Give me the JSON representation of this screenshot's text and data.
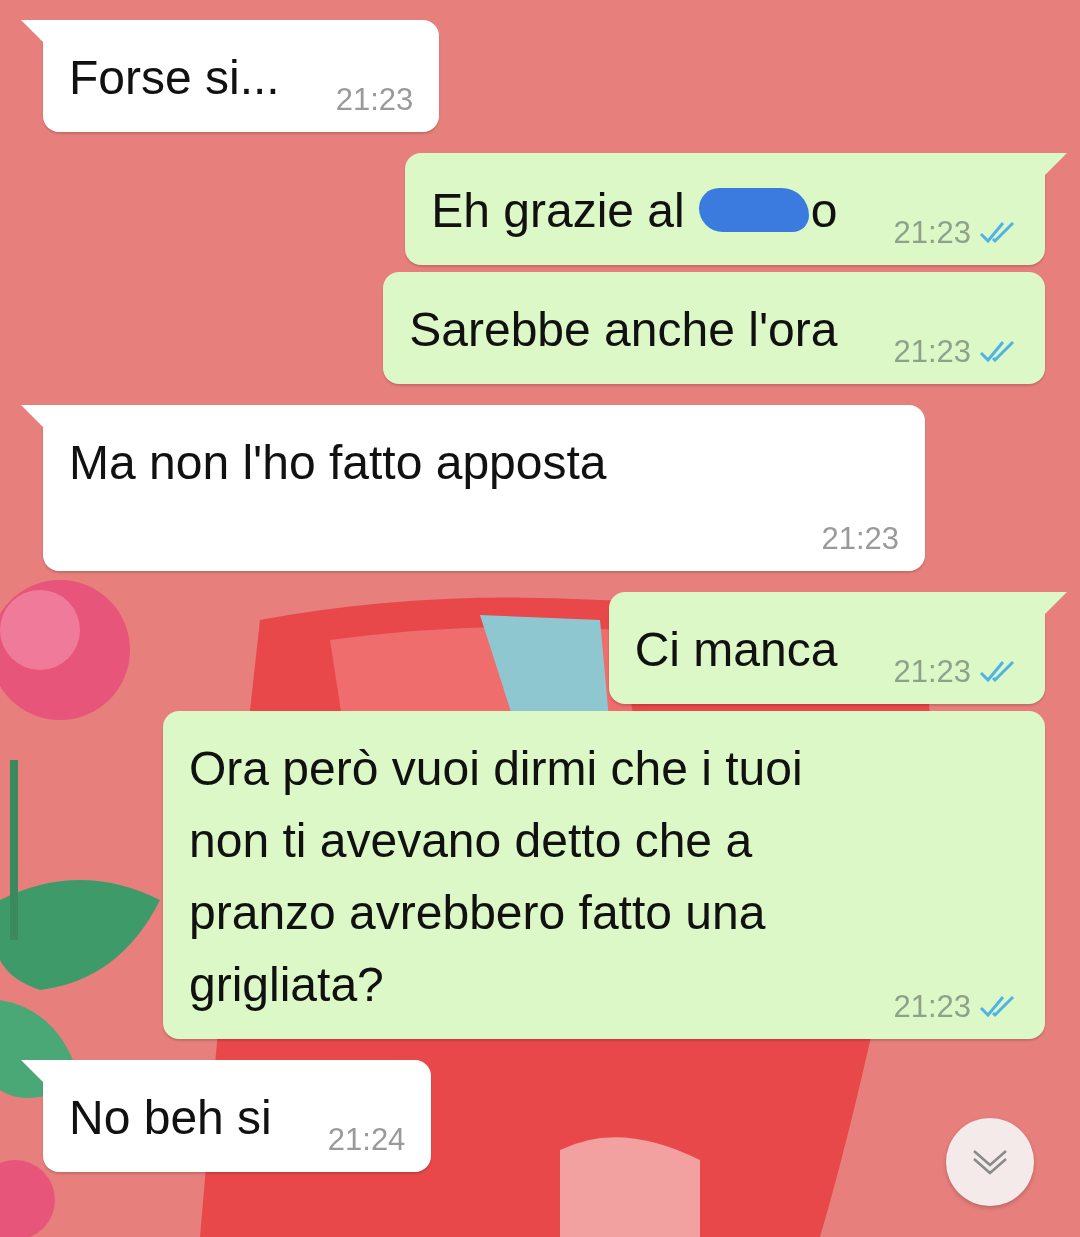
{
  "messages": [
    {
      "outgoing": false,
      "tail": true,
      "time_on_own_line": false,
      "segments": [
        {
          "kind": "text",
          "text": "Forse si..."
        }
      ],
      "time": "21:23"
    },
    {
      "outgoing": true,
      "tail": true,
      "time_on_own_line": false,
      "segments": [
        {
          "kind": "text",
          "text": "Eh grazie al"
        },
        {
          "kind": "redaction"
        },
        {
          "kind": "text",
          "text": "o"
        }
      ],
      "time": "21:23",
      "read": true
    },
    {
      "outgoing": true,
      "tail": false,
      "time_on_own_line": false,
      "segments": [
        {
          "kind": "text",
          "text": "Sarebbe anche l'ora"
        }
      ],
      "time": "21:23",
      "read": true
    },
    {
      "outgoing": false,
      "tail": true,
      "time_on_own_line": true,
      "segments": [
        {
          "kind": "text",
          "text": "Ma non l'ho fatto apposta"
        }
      ],
      "time": "21:23"
    },
    {
      "outgoing": true,
      "tail": true,
      "time_on_own_line": false,
      "segments": [
        {
          "kind": "text",
          "text": "Ci manca"
        }
      ],
      "time": "21:23",
      "read": true
    },
    {
      "outgoing": true,
      "tail": false,
      "time_on_own_line": false,
      "segments": [
        {
          "kind": "text",
          "text": "Ora però vuoi dirmi che i tuoi non ti avevano detto che a pranzo avrebbero fatto una grigliata?"
        }
      ],
      "time": "21:23",
      "read": true
    },
    {
      "outgoing": false,
      "tail": true,
      "time_on_own_line": false,
      "segments": [
        {
          "kind": "text",
          "text": "No beh si"
        }
      ],
      "time": "21:24"
    }
  ],
  "scroll_button": {
    "kind": "scroll-down"
  }
}
